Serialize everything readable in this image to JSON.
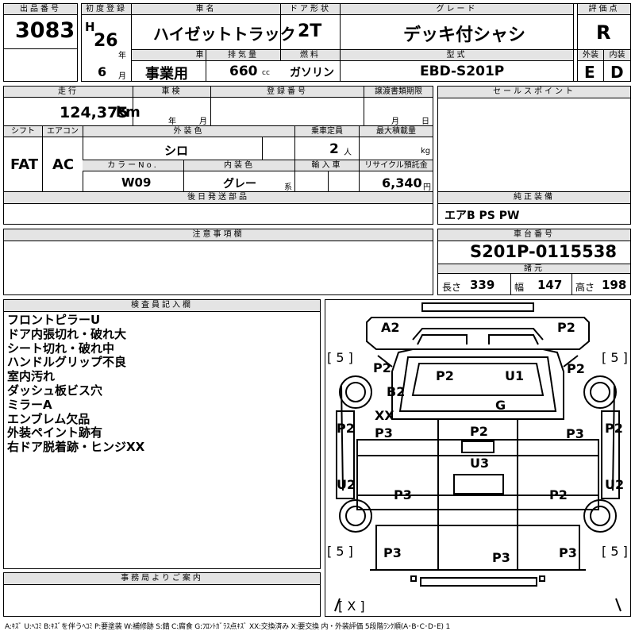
{
  "header_row1": {
    "lot_label": "出品番号",
    "lot": "3083",
    "first_reg_label": "初度登録",
    "era": "H",
    "year": "26",
    "year_unit": "年",
    "month": "6",
    "month_unit": "月",
    "car_name_label": "車名",
    "car_name": "ハイゼットトラック",
    "door_label": "ドア形状",
    "door": "2T",
    "grade_label": "グレード",
    "grade": "デッキ付シャシ",
    "score_label": "評価点",
    "score": "R",
    "history_label": "車歴",
    "history": "事業用",
    "displacement_label": "排気量",
    "displacement": "660",
    "displacement_unit": "cc",
    "fuel_label": "燃料",
    "fuel": "ガソリン",
    "model_label": "型式",
    "model": "EBD-S201P",
    "exterior_label": "外装",
    "exterior": "E",
    "interior_label": "内装",
    "interior": "D"
  },
  "row2": {
    "mileage_label": "走行",
    "mileage": "124,375",
    "mileage_unit": "km",
    "inspection_label": "車検",
    "insp_year_unit": "年",
    "insp_month_unit": "月",
    "reg_no_label": "登録番号",
    "transfer_label": "譲渡書類期限",
    "transfer_month_unit": "月",
    "transfer_day_unit": "日",
    "shift_label": "シフト",
    "shift": "FAT",
    "ac_label": "エアコン",
    "ac": "AC",
    "ext_color_label": "外装色",
    "ext_color": "シロ",
    "capacity_label": "乗車定員",
    "capacity": "2",
    "capacity_unit": "人",
    "max_load_label": "最大積載量",
    "max_load_unit": "kg",
    "color_no_label": "カラーNo.",
    "color_no": "W09",
    "int_color_label": "内装色",
    "int_color": "グレー",
    "int_color_suffix": "系",
    "import_label": "輸入車",
    "recycle_label": "リサイクル預託金",
    "recycle": "6,340",
    "recycle_unit": "円",
    "later_parts_label": "後日発送部品"
  },
  "sales_point_label": "セールスポイント",
  "genuine_label": "純正装備",
  "genuine": "エアB PS PW",
  "chassis_label": "車台番号",
  "chassis": "S201P-0115538",
  "dims_label": "諸元",
  "length_label": "長さ",
  "length": "339",
  "width_label": "幅",
  "width": "147",
  "height_label": "高さ",
  "height": "198",
  "notes_label": "注意事項欄",
  "inspector_label": "検査員記入欄",
  "inspector_notes": [
    "フロントピラーU",
    "ドア内張切れ・破れ大",
    "シート切れ・破れ中",
    "ハンドルグリップ不良",
    "室内汚れ",
    "ダッシュ板ビス穴",
    "ミラーA",
    "エンブレム欠品",
    "外装ペイント跡有",
    "右ドア脱着跡・ヒンジXX"
  ],
  "office_label": "事務局よりご案内",
  "diagram": {
    "marks": [
      "A2",
      "P2",
      "[ 5 ]",
      "[ 5 ]",
      "P2",
      "P2",
      "U1",
      "P2",
      "B2",
      "G",
      "XX",
      "P2",
      "P3",
      "P2",
      "P3",
      "P2",
      "U3",
      "U2",
      "U2",
      "P3",
      "P2",
      "[ 5 ]",
      "[ 5 ]",
      "P3",
      "P3",
      "P3",
      "[ X ]"
    ]
  },
  "legend": "A:ｷｽﾞ U:ﾍｺﾐ B:ｷｽﾞを伴うﾍｺﾐ P:要塗装 W:補修跡 S:錆 C:腐食 G:ﾌﾛﾝﾄｶﾞﾗｽ点ｷｽﾞ XX:交換済み X:要交換 内・外装評価 5段階ﾗﾝｸ順(A･B･C･D･E) 1"
}
